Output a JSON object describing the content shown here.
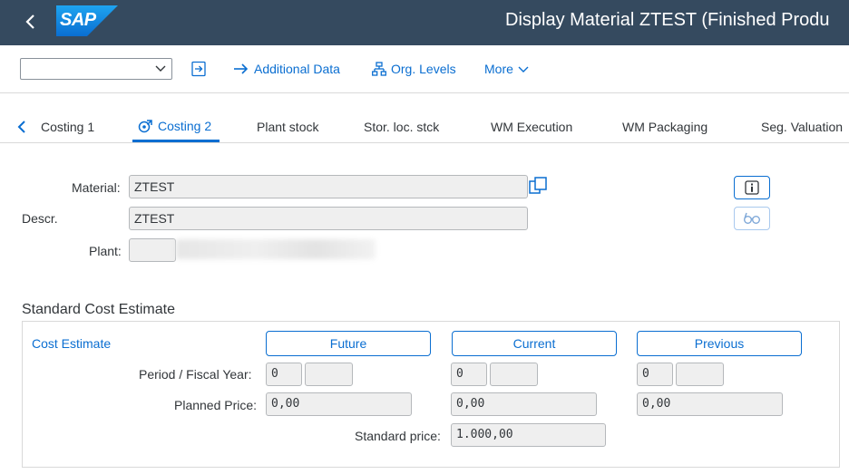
{
  "header": {
    "logo_text": "SAP",
    "title": "Display Material ZTEST (Finished Produ"
  },
  "toolbar": {
    "combo_value": "",
    "additional_data": "Additional Data",
    "org_levels": "Org. Levels",
    "more": "More"
  },
  "tabs": [
    {
      "label": "Costing 1"
    },
    {
      "label": "Costing 2"
    },
    {
      "label": "Plant stock"
    },
    {
      "label": "Stor. loc. stck"
    },
    {
      "label": "WM Execution"
    },
    {
      "label": "WM Packaging"
    },
    {
      "label": "Seg. Valuation"
    }
  ],
  "form": {
    "material_label": "Material:",
    "material_value": "ZTEST",
    "descr_label": "Descr.",
    "descr_value": "ZTEST",
    "plant_label": "Plant:",
    "plant_value": ""
  },
  "standard_cost": {
    "section_title": "Standard Cost Estimate",
    "cost_estimate_link": "Cost Estimate",
    "future_label": "Future",
    "current_label": "Current",
    "previous_label": "Previous",
    "period_label": "Period / Fiscal Year:",
    "planned_price_label": "Planned Price:",
    "standard_price_label": "Standard price:",
    "future": {
      "period": "0",
      "year": "",
      "planned_price": "0,00"
    },
    "current": {
      "period": "0",
      "year": "",
      "planned_price": "0,00"
    },
    "previous": {
      "period": "0",
      "year": "",
      "planned_price": "0,00"
    },
    "standard_price": "1.000,00"
  },
  "colors": {
    "shell": "#354a5f",
    "accent": "#0a6ed1",
    "text": "#32363a",
    "field_bg": "#efefef"
  }
}
